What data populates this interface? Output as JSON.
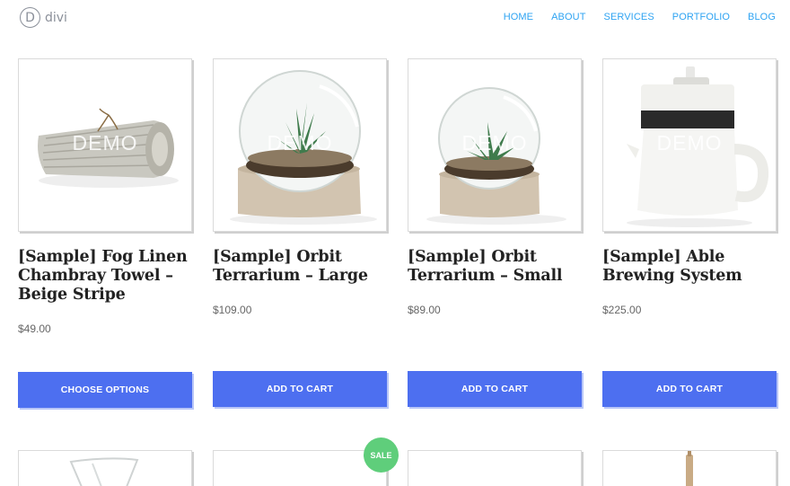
{
  "header": {
    "logo_letter": "D",
    "logo_text": "divi",
    "nav": [
      "HOME",
      "ABOUT",
      "SERVICES",
      "PORTFOLIO",
      "BLOG"
    ]
  },
  "watermark": "DEMO",
  "products": [
    {
      "title": "[Sample] Fog Linen Chambray Towel – Beige Stripe",
      "price": "$49.00",
      "button": "CHOOSE OPTIONS",
      "image": "rolled-towel"
    },
    {
      "title": "[Sample] Orbit Terrarium – Large",
      "price": "$109.00",
      "button": "ADD TO CART",
      "image": "terrarium-large"
    },
    {
      "title": "[Sample] Orbit Terrarium – Small",
      "price": "$89.00",
      "button": "ADD TO CART",
      "image": "terrarium-small"
    },
    {
      "title": "[Sample] Able Brewing System",
      "price": "$225.00",
      "button": "ADD TO CART",
      "image": "brewing-system"
    }
  ],
  "sale_badge": "SALE",
  "colors": {
    "accent": "#4d6ff0",
    "nav": "#2ea3f2",
    "sale": "#5fce7b"
  }
}
